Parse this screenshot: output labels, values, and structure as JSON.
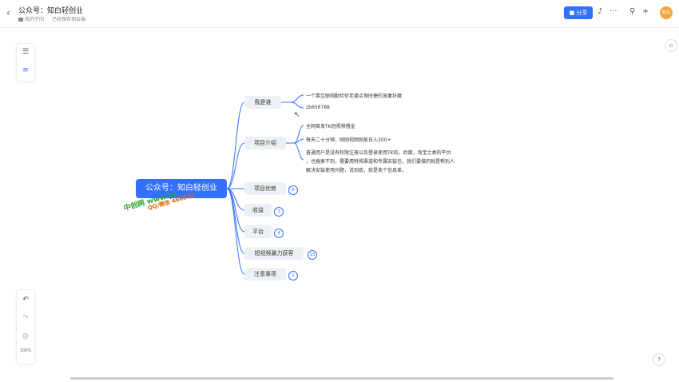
{
  "header": {
    "back_icon": "chevron-left-icon",
    "title": "公众号：知白轻创业",
    "star_icon": "star-outline-icon",
    "breadcrumb": "我的空间",
    "save_status": "已经保存到云端",
    "share_label": "分享",
    "bell_icon": "bell-icon",
    "more_icon": "more-icon",
    "search_icon": "search-icon",
    "add_icon": "plus-icon",
    "avatar_text": "知白"
  },
  "left_toolbar": {
    "outline_icon": "list-icon",
    "structure_icon": "tree-structure-icon",
    "undo_icon": "undo-icon",
    "redo_icon": "redo-icon",
    "locate_icon": "locate-icon",
    "zoom": "100%"
  },
  "mindmap": {
    "root": "公众号：知白轻创业",
    "branches": [
      {
        "label": "我是谁",
        "children": [
          "一个靠互联网勤俭伦老婆买保时捷的宠妻狂魔",
          "zb656788"
        ]
      },
      {
        "label": "项目介绍",
        "children": [
          "全网首发TK短视频撸金",
          "每天二十分钟，刚刚视频就能日入300+",
          "普通用户是没有权限注册以及登录使用TK的，后度，淘宝之类的平台",
          "，也搜索不到，需要用特殊渠道和专属安装包，我们要做的就是帮别人",
          "解决安装使用问题，说到底，就是卖个信息差。"
        ]
      },
      {
        "label": "项目优势",
        "badge": "6"
      },
      {
        "label": "收益",
        "badge": "3"
      },
      {
        "label": "平台",
        "badge": "4"
      },
      {
        "label": "短视频暴力获客",
        "badge": "15"
      },
      {
        "label": "注意事项",
        "badge": "1"
      }
    ]
  },
  "watermark": {
    "line1": "中创网 www.yc",
    "line2": "QQ/微信 466832"
  },
  "colors": {
    "accent": "#3370ff",
    "node_bg": "#edf1f6",
    "watermark_green": "#2ea02e",
    "watermark_orange": "#d46b08"
  }
}
